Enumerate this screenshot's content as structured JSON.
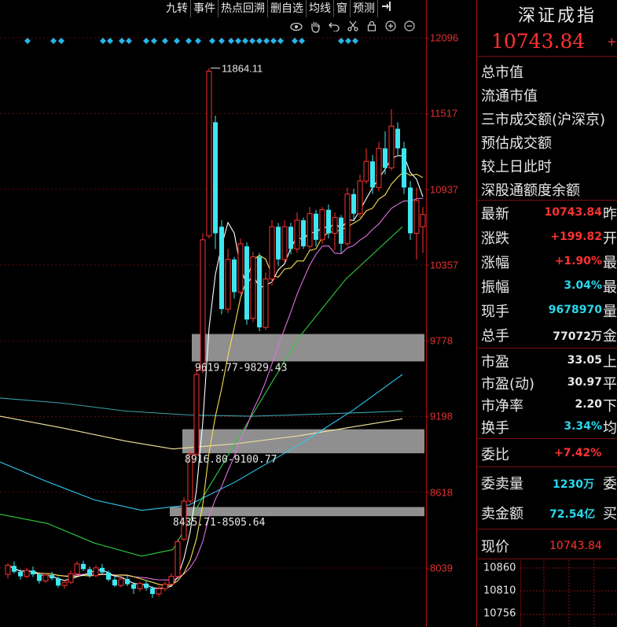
{
  "toolbar": {
    "items": [
      "九转",
      "事件",
      "热点回溯",
      "删自选",
      "均线",
      "窗",
      "预测"
    ],
    "exit_icon": "exit-icon"
  },
  "chart_tools": [
    "eye-icon",
    "hand-icon",
    "undo-icon",
    "scissors-icon",
    "lock-icon",
    "zoom-in-icon",
    "zoom-out-icon"
  ],
  "chart_data": {
    "type": "candlestick",
    "y_ticks": [
      "12096",
      "11517",
      "10937",
      "10357",
      "9778",
      "9198",
      "8618",
      "8039"
    ],
    "ylim": [
      7880,
      12400
    ],
    "annotations": {
      "high_label": "11864.11",
      "gap_labels": [
        "9619.77-9829.43",
        "8916.80-9100.77",
        "8435.71-8505.64"
      ]
    },
    "gaps": [
      [
        9619.77,
        9829.43
      ],
      [
        8916.8,
        9100.77
      ],
      [
        8435.71,
        8505.64
      ]
    ],
    "colors": {
      "up": "#ff3232",
      "down": "#3ee6f0",
      "bg": "#000000"
    },
    "candles": [
      [
        7990,
        8060,
        7960,
        8075
      ],
      [
        8055,
        8010,
        7995,
        8090
      ],
      [
        8010,
        7975,
        7950,
        8030
      ],
      [
        7975,
        8020,
        7960,
        8040
      ],
      [
        8020,
        7990,
        7970,
        8050
      ],
      [
        7990,
        7940,
        7920,
        8005
      ],
      [
        7940,
        7985,
        7925,
        8000
      ],
      [
        7985,
        7960,
        7945,
        8010
      ],
      [
        7960,
        7905,
        7890,
        7975
      ],
      [
        7905,
        7930,
        7880,
        7950
      ],
      [
        7930,
        7995,
        7915,
        8020
      ],
      [
        7995,
        8070,
        7980,
        8090
      ],
      [
        8070,
        8030,
        8015,
        8095
      ],
      [
        8030,
        7980,
        7965,
        8050
      ],
      [
        7980,
        8040,
        7970,
        8060
      ],
      [
        8040,
        8005,
        7990,
        8070
      ],
      [
        8005,
        7950,
        7935,
        8020
      ],
      [
        7950,
        7905,
        7895,
        7970
      ],
      [
        7905,
        7955,
        7890,
        7970
      ],
      [
        7955,
        7915,
        7900,
        7985
      ],
      [
        7915,
        7880,
        7840,
        7930
      ],
      [
        7880,
        7920,
        7860,
        7935
      ],
      [
        7920,
        7885,
        7865,
        7945
      ],
      [
        7885,
        7840,
        7810,
        7900
      ],
      [
        7840,
        7880,
        7820,
        7900
      ],
      [
        7880,
        7915,
        7860,
        7935
      ],
      [
        7915,
        7975,
        7905,
        8000
      ],
      [
        7975,
        8240,
        7965,
        8260
      ],
      [
        8260,
        8550,
        8245,
        8580
      ],
      [
        8550,
        8910,
        8535,
        8940
      ],
      [
        8910,
        9520,
        8900,
        9580
      ],
      [
        9550,
        10550,
        9530,
        10600
      ],
      [
        10580,
        11840,
        10560,
        11864.11
      ],
      [
        11450,
        10600,
        10480,
        11500
      ],
      [
        10650,
        10020,
        9980,
        10700
      ],
      [
        10020,
        10400,
        9990,
        10480
      ],
      [
        10400,
        10150,
        10100,
        10420
      ],
      [
        10150,
        10520,
        10130,
        10560
      ],
      [
        10500,
        9940,
        9900,
        10530
      ],
      [
        9950,
        10420,
        9920,
        10460
      ],
      [
        10420,
        9880,
        9850,
        10450
      ],
      [
        9880,
        10250,
        9860,
        10300
      ],
      [
        10250,
        10650,
        10200,
        10700
      ],
      [
        10650,
        10400,
        10350,
        10680
      ],
      [
        10400,
        10650,
        10380,
        10700
      ],
      [
        10650,
        10480,
        10440,
        10680
      ],
      [
        10480,
        10700,
        10450,
        10760
      ],
      [
        10700,
        10500,
        10480,
        10720
      ],
      [
        10500,
        10750,
        10470,
        10800
      ],
      [
        10750,
        10550,
        10500,
        10780
      ],
      [
        10550,
        10780,
        10520,
        10800
      ],
      [
        10780,
        10600,
        10560,
        10820
      ],
      [
        10600,
        10720,
        10470,
        10760
      ],
      [
        10720,
        10520,
        10450,
        10740
      ],
      [
        10520,
        10900,
        10500,
        10950
      ],
      [
        10900,
        10750,
        10700,
        10940
      ],
      [
        10750,
        11000,
        10720,
        11050
      ],
      [
        11000,
        11150,
        10980,
        11250
      ],
      [
        11150,
        10950,
        10900,
        11200
      ],
      [
        10950,
        11250,
        10920,
        11300
      ],
      [
        11250,
        11100,
        11050,
        11380
      ],
      [
        11100,
        11420,
        11080,
        11550
      ],
      [
        11400,
        11250,
        11200,
        11450
      ],
      [
        11250,
        10950,
        10900,
        11300
      ],
      [
        10950,
        10600,
        10550,
        11000
      ],
      [
        10600,
        10850,
        10400,
        10950
      ],
      [
        10650,
        10743.84,
        10450,
        10800
      ]
    ]
  },
  "right_panel": {
    "title": "深证成指",
    "price": "10743.84",
    "price_extra": "+",
    "labels": [
      "总市值",
      "流通市值",
      "三市成交额(沪深京)",
      "预估成交额",
      "较上日此时",
      "深股通额度余额"
    ],
    "rows": [
      {
        "label": "最新",
        "value": "10743.84",
        "color": "red",
        "tail": "昨"
      },
      {
        "label": "涨跌",
        "value": "+199.82",
        "color": "red",
        "tail": "开"
      },
      {
        "label": "涨幅",
        "value": "+1.90%",
        "color": "red",
        "tail": "最"
      },
      {
        "label": "振幅",
        "value": "3.04%",
        "color": "cyan",
        "tail": "最"
      },
      {
        "label": "现手",
        "value": "9678970",
        "color": "cyan",
        "tail": "量"
      },
      {
        "label": "总手",
        "value": "77072万",
        "color": "white",
        "tail": "金"
      }
    ],
    "rows2": [
      {
        "label": "市盈",
        "value": "33.05",
        "color": "white",
        "tail": "上"
      },
      {
        "label": "市盈(动)",
        "value": "30.97",
        "color": "white",
        "tail": "平"
      },
      {
        "label": "市净率",
        "value": "2.20",
        "color": "white",
        "tail": "下"
      },
      {
        "label": "换手",
        "value": "3.34%",
        "color": "cyan",
        "tail": "均"
      }
    ],
    "weibi": {
      "label": "委比",
      "value": "+7.42%",
      "color": "red"
    },
    "weimailiang": {
      "label": "委卖量",
      "value": "1230万",
      "color": "cyan",
      "tail": "委"
    },
    "maijine": {
      "label": "卖金额",
      "value": "72.54亿",
      "color": "cyan",
      "tail": "买"
    },
    "xianjia": {
      "label": "现价",
      "value": "10743.84",
      "color": "red"
    },
    "mini_ticks": [
      "10860",
      "10810",
      "10756"
    ]
  }
}
